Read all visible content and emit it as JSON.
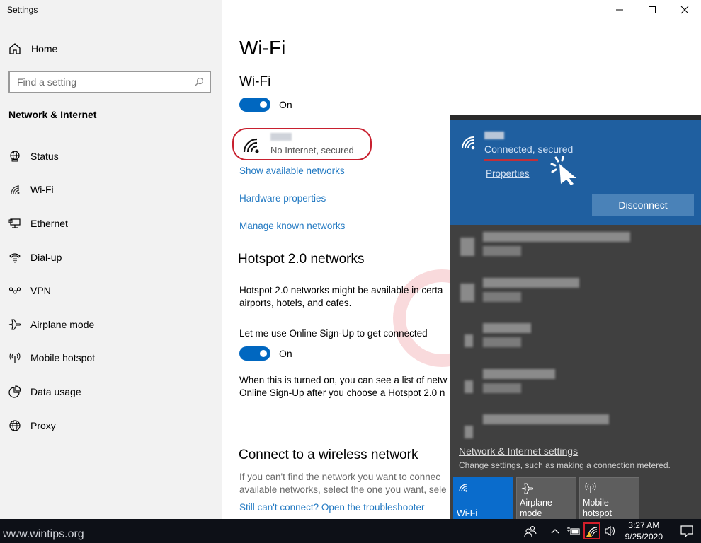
{
  "window": {
    "title": "Settings",
    "buttons": [
      "minimize",
      "maximize",
      "close"
    ]
  },
  "sidebar": {
    "home_label": "Home",
    "search_placeholder": "Find a setting",
    "section_title": "Network & Internet",
    "items": [
      {
        "label": "Status",
        "icon": "globe-monitor-icon"
      },
      {
        "label": "Wi-Fi",
        "icon": "wifi-icon"
      },
      {
        "label": "Ethernet",
        "icon": "ethernet-icon"
      },
      {
        "label": "Dial-up",
        "icon": "phone-icon"
      },
      {
        "label": "VPN",
        "icon": "vpn-icon"
      },
      {
        "label": "Airplane mode",
        "icon": "airplane-icon"
      },
      {
        "label": "Mobile hotspot",
        "icon": "hotspot-icon"
      },
      {
        "label": "Data usage",
        "icon": "pie-icon"
      },
      {
        "label": "Proxy",
        "icon": "globe-icon"
      }
    ]
  },
  "main": {
    "page_title": "Wi-Fi",
    "wifi_section_title": "Wi-Fi",
    "wifi_toggle": {
      "state": "on",
      "label": "On"
    },
    "network_status": "No Internet, secured",
    "links": {
      "show_networks": "Show available networks",
      "hardware": "Hardware properties",
      "manage": "Manage known networks"
    },
    "hotspot": {
      "title": "Hotspot 2.0 networks",
      "description_line1": "Hotspot 2.0 networks might be available in certa",
      "description_line2": "airports, hotels, and cafes.",
      "signup_label": "Let me use Online Sign-Up to get connected",
      "signup_toggle": {
        "state": "on",
        "label": "On"
      },
      "signup_desc_line1": "When this is turned on, you can see a list of netw",
      "signup_desc_line2": "Online Sign-Up after you choose a Hotspot 2.0 n"
    },
    "connect": {
      "title": "Connect to a wireless network",
      "desc_line1": "If you can't find the network you want to connec",
      "desc_line2": "available networks, select the one you want, sele",
      "troubleshoot_link": "Still can't connect? Open the troubleshooter"
    }
  },
  "flyout": {
    "connected": {
      "status": "Connected, secured",
      "properties_label": "Properties",
      "disconnect_label": "Disconnect"
    },
    "networks_count_obscured": 5,
    "settings_link": "Network & Internet settings",
    "settings_sub": "Change settings, such as making a connection metered.",
    "tiles": [
      {
        "label": "Wi-Fi",
        "active": true,
        "icon": "wifi-icon"
      },
      {
        "label": "Airplane mode",
        "active": false,
        "icon": "airplane-icon"
      },
      {
        "label": "Mobile\nhotspot",
        "active": false,
        "icon": "hotspot-icon"
      }
    ]
  },
  "taskbar": {
    "site": "www.wintips.org",
    "time": "3:27 AM",
    "date": "9/25/2020"
  },
  "colors": {
    "accent": "#0067c0",
    "link": "#2279c2",
    "highlight_red": "#c8202f",
    "flyout_connected": "#1f5fa0",
    "flyout_bg": "#404040"
  }
}
